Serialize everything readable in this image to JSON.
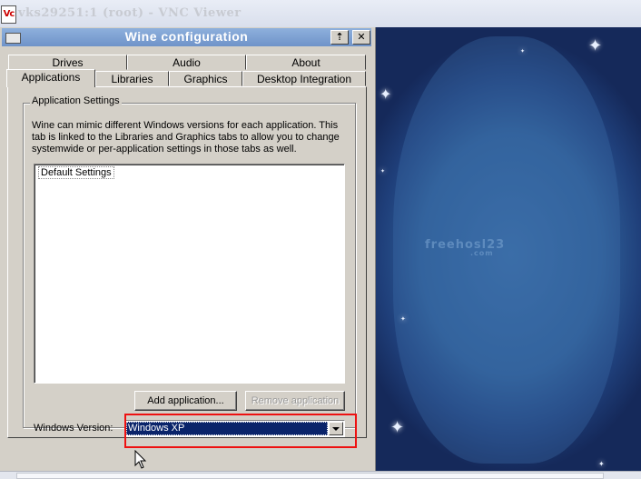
{
  "vnc": {
    "logo": "Vc",
    "title": "vks29251:1 (root) - VNC Viewer"
  },
  "window": {
    "title": "Wine configuration",
    "buttons": {
      "sys": "system-menu",
      "maximize": "⇡",
      "close": "✕"
    }
  },
  "tabs": {
    "top_row": [
      "Drives",
      "Audio",
      "About"
    ],
    "bottom_row": [
      "Applications",
      "Libraries",
      "Graphics",
      "Desktop Integration"
    ],
    "active": "Applications"
  },
  "app_settings": {
    "group_label": "Application Settings",
    "description": "Wine can mimic different Windows versions for each application.  This tab is linked to the Libraries and Graphics tabs to allow you to change systemwide or per-application settings in those tabs as well.",
    "list_items": [
      "Default Settings"
    ],
    "add_button": "Add application...",
    "remove_button": "Remove application",
    "version_label": "Windows Version:",
    "version_value": "Windows XP"
  },
  "desktop": {
    "watermark": "freehosl23",
    "watermark_sub": ".com"
  },
  "colors": {
    "titlebar": "#7a9fd2",
    "selection": "#0a246a",
    "highlight_box": "#e11111",
    "desktop_blue": "#2f5f98"
  }
}
